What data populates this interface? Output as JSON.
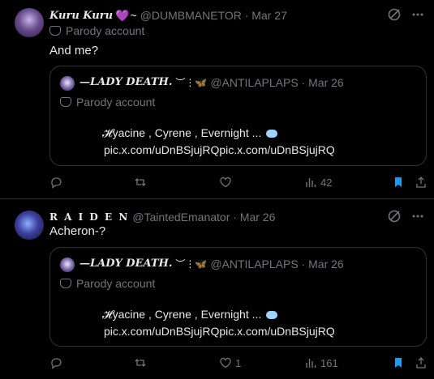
{
  "tweets": [
    {
      "display_name": "Kuru Kuru",
      "name_suffix_heart": "💜",
      "name_suffix": "~",
      "handle_line": "@DUMBMANETOR · Mar 27",
      "parody_label": "Parody account",
      "text": "And me?",
      "quote": {
        "display_name": "—LADY DEATH.",
        "name_deco": "︶⋮🦋",
        "handle_line": "@ANTILAPLAPS · Mar 26",
        "parody_label": "Parody account",
        "line1": "𝓗yacine , Cyrene , Evernight ...",
        "line2": "pic.x.com/uDnBSjujRQpic.x.com/uDnBSjujRQ"
      },
      "actions": {
        "reply": "",
        "retweet": "",
        "like": "",
        "views": "42"
      }
    },
    {
      "display_name": "R A I D E N",
      "handle_line": "@TaintedEmanator · Mar 26",
      "text": "Acheron-?",
      "quote": {
        "display_name": "—LADY DEATH.",
        "name_deco": "︶⋮🦋",
        "handle_line": "@ANTILAPLAPS · Mar 26",
        "parody_label": "Parody account",
        "line1": "𝓗yacine , Cyrene , Evernight ...",
        "line2": "pic.x.com/uDnBSjujRQpic.x.com/uDnBSjujRQ"
      },
      "actions": {
        "reply": "",
        "retweet": "",
        "like": "1",
        "views": "161"
      }
    }
  ],
  "colors": {
    "bg": "#000000",
    "text": "#e7e9ea",
    "muted": "#71767b",
    "accent": "#1d9bf0",
    "border": "#2f3336"
  },
  "icons": [
    "grok-icon",
    "more-icon",
    "reply-icon",
    "retweet-icon",
    "like-icon",
    "views-icon",
    "bookmark-icon",
    "share-icon",
    "parody-mask-icon"
  ]
}
